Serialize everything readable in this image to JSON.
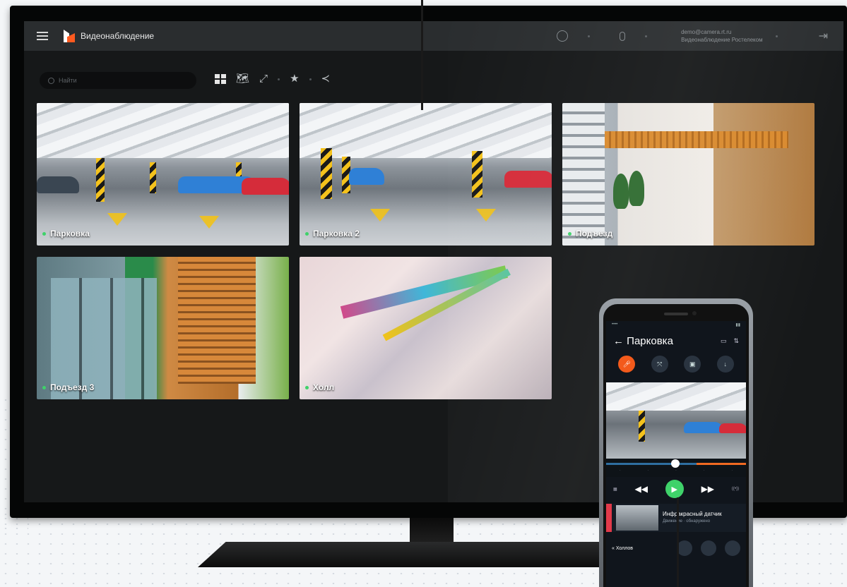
{
  "app": {
    "brand": "Видеонаблюдение",
    "user_email": "demo@camera.rt.ru",
    "user_org": "Видеонаблюдение Ростелеком"
  },
  "search": {
    "placeholder": "Найти"
  },
  "toolbar": {
    "icons": [
      "grid-icon",
      "map-icon",
      "fullscreen-icon",
      "star-icon",
      "share-icon"
    ]
  },
  "cameras": [
    {
      "label": "Парковка"
    },
    {
      "label": "Парковка 2"
    },
    {
      "label": "Подъезд"
    },
    {
      "label": "Подъезд 3"
    },
    {
      "label": "Холл"
    }
  ],
  "phone": {
    "title": "← Парковка",
    "event_title": "Инфракрасный датчик",
    "event_sub": "Движение · обнаружено",
    "footer_label": "« Холлов"
  },
  "colors": {
    "accent": "#f35a1b",
    "online": "#3fd26a",
    "tv_bg": "#161819"
  }
}
